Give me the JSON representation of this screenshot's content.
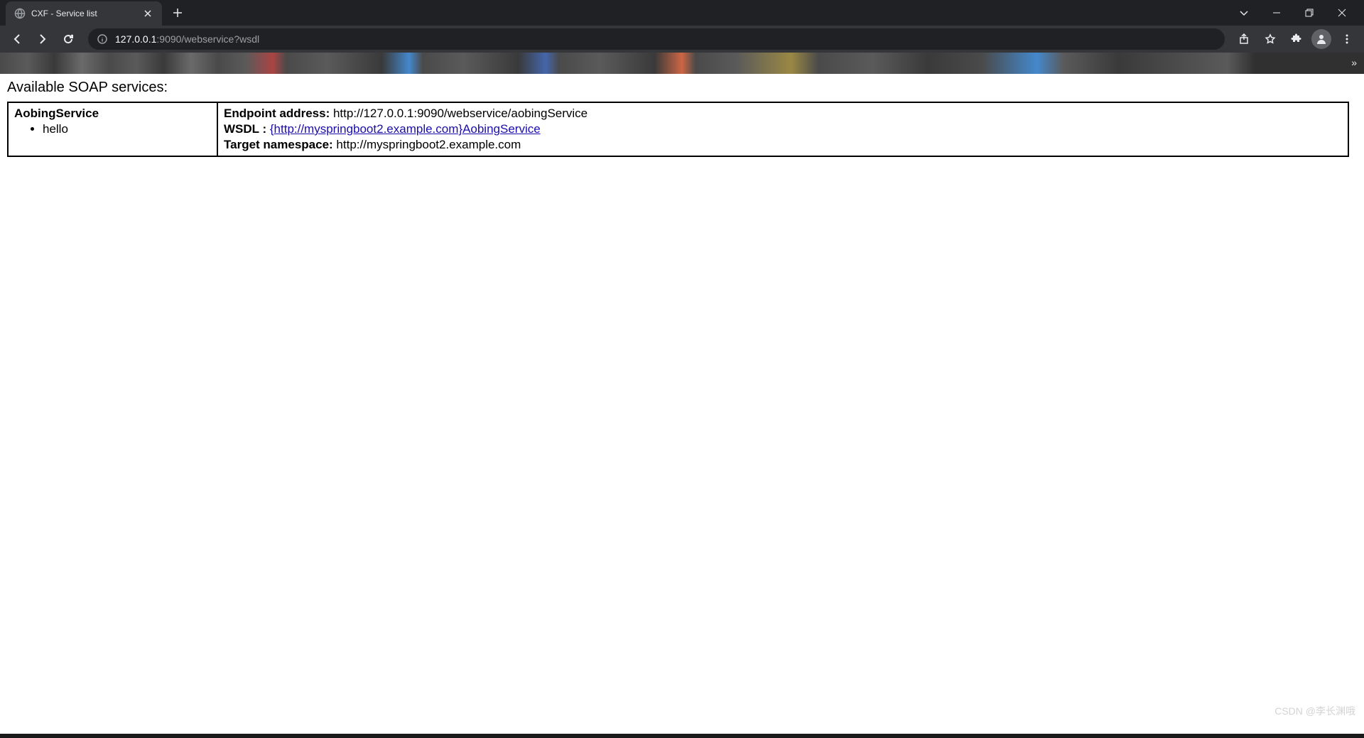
{
  "browser": {
    "tab": {
      "title": "CXF - Service list"
    },
    "url": {
      "host": "127.0.0.1",
      "port_path": ":9090/webservice?wsdl"
    }
  },
  "page": {
    "heading": "Available SOAP services:",
    "service": {
      "name": "AobingService",
      "methods": [
        "hello"
      ],
      "endpoint_label": "Endpoint address:",
      "endpoint_value": " http://127.0.0.1:9090/webservice/aobingService",
      "wsdl_label": "WSDL :",
      "wsdl_link": "{http://myspringboot2.example.com}AobingService",
      "namespace_label": "Target namespace:",
      "namespace_value": " http://myspringboot2.example.com"
    }
  },
  "watermark": "CSDN @李长渊哦"
}
